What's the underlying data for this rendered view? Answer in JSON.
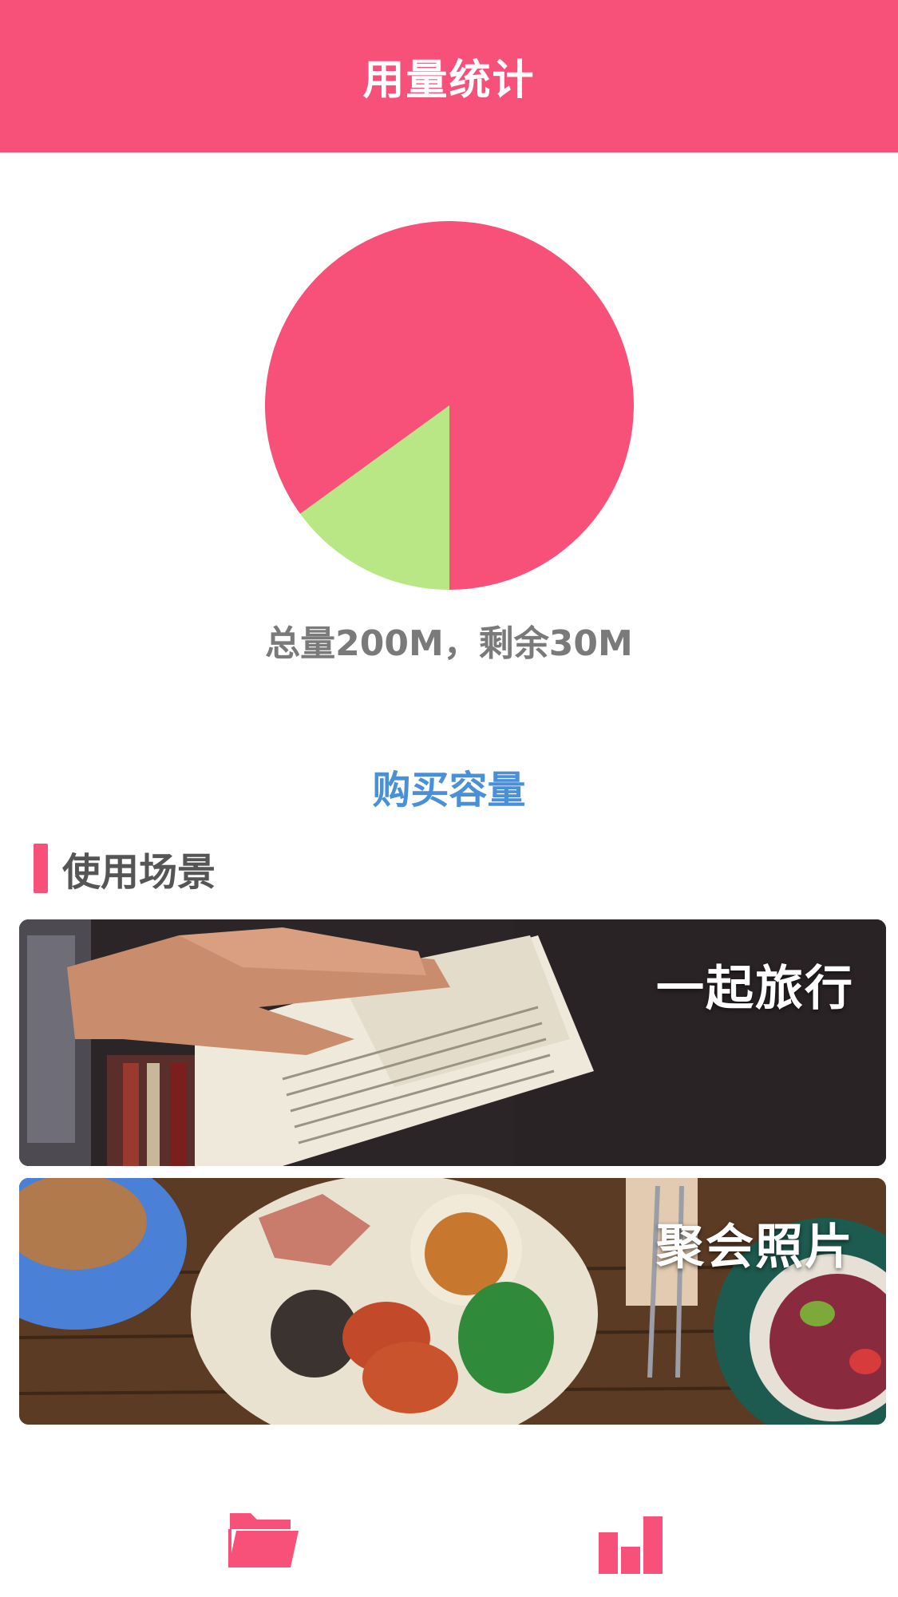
{
  "header": {
    "title": "用量统计"
  },
  "usage": {
    "summary_text": "总量200M，剩余30M",
    "total_mb": 200,
    "remaining_mb": 30,
    "used_color": "#f75079",
    "remaining_color": "#b9e786"
  },
  "chart_data": {
    "type": "pie",
    "values": [
      170,
      30
    ],
    "colors": [
      "#f75079",
      "#b9e786"
    ]
  },
  "buy": {
    "label": "购买容量"
  },
  "scenes": {
    "title": "使用场景",
    "items": [
      {
        "label": "一起旅行"
      },
      {
        "label": "聚会照片"
      }
    ]
  },
  "tabbar": {
    "items": [
      {
        "icon": "folder-icon"
      },
      {
        "icon": "bar-chart-icon"
      }
    ]
  },
  "colors": {
    "accent": "#f75079",
    "link": "#4a90d9"
  }
}
